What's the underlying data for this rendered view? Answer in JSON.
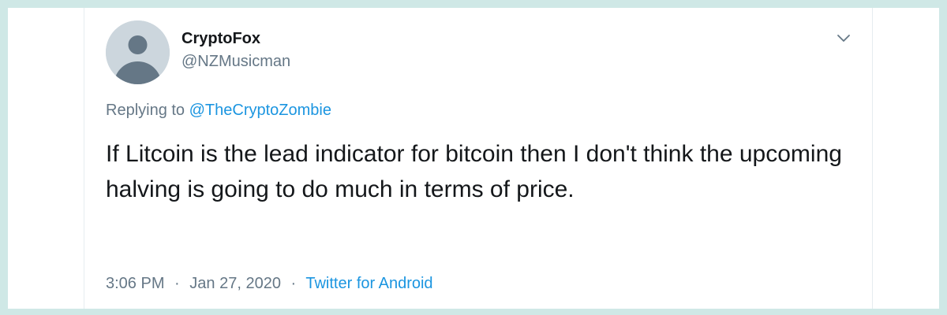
{
  "tweet": {
    "author": {
      "display_name": "CryptoFox",
      "handle": "@NZMusicman",
      "avatar_icon": "default-profile-avatar"
    },
    "menu_icon": "chevron-down-icon",
    "reply": {
      "prefix": "Replying to",
      "mention": "@TheCryptoZombie"
    },
    "text": "If Litcoin is the lead indicator for bitcoin then I don't think the upcoming halving is going to do much in terms of price.",
    "meta": {
      "time": "3:06 PM",
      "date": "Jan 27, 2020",
      "separator": "·",
      "source": "Twitter for Android"
    }
  },
  "colors": {
    "background_border": "#cfe8e6",
    "text_primary": "#14171a",
    "text_secondary": "#657786",
    "link": "#1b95e0",
    "avatar_bg": "#ccd6dd",
    "avatar_figure": "#657786"
  }
}
